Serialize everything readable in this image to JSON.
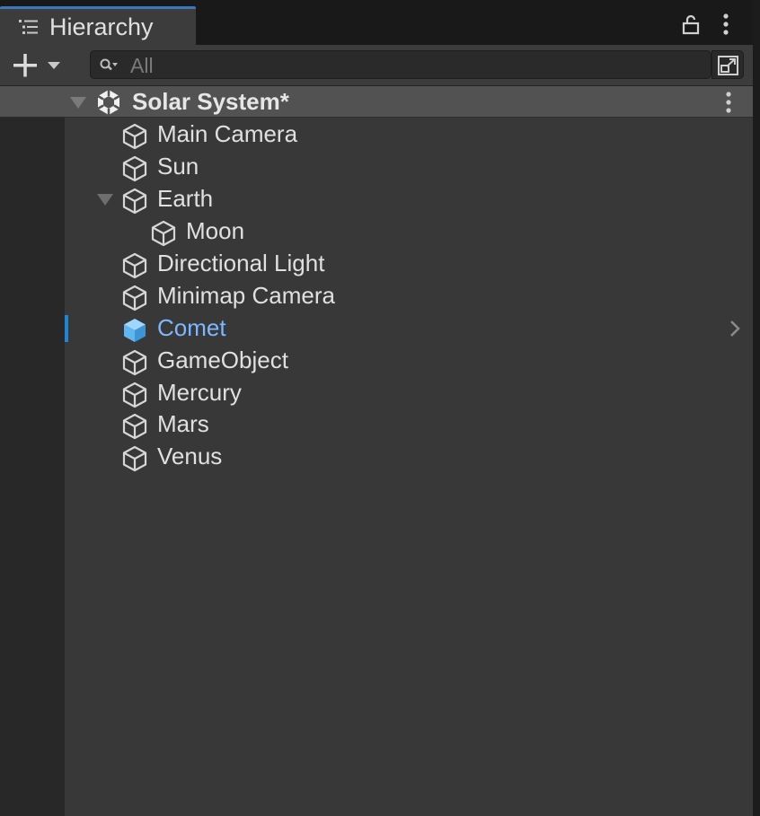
{
  "window": {
    "tab_title": "Hierarchy"
  },
  "toolbar": {
    "search_placeholder": "All"
  },
  "scene": {
    "name": "Solar System*"
  },
  "tree": [
    {
      "label": "Main Camera",
      "depth": 1,
      "expanded": null,
      "selected": false
    },
    {
      "label": "Sun",
      "depth": 1,
      "expanded": null,
      "selected": false
    },
    {
      "label": "Earth",
      "depth": 1,
      "expanded": true,
      "selected": false
    },
    {
      "label": "Moon",
      "depth": 2,
      "expanded": null,
      "selected": false
    },
    {
      "label": "Directional Light",
      "depth": 1,
      "expanded": null,
      "selected": false
    },
    {
      "label": "Minimap Camera",
      "depth": 1,
      "expanded": null,
      "selected": false
    },
    {
      "label": "Comet",
      "depth": 1,
      "expanded": null,
      "selected": true
    },
    {
      "label": "GameObject",
      "depth": 1,
      "expanded": null,
      "selected": false
    },
    {
      "label": "Mercury",
      "depth": 1,
      "expanded": null,
      "selected": false
    },
    {
      "label": "Mars",
      "depth": 1,
      "expanded": null,
      "selected": false
    },
    {
      "label": "Venus",
      "depth": 1,
      "expanded": null,
      "selected": false
    }
  ],
  "colors": {
    "accent": "#3a79bb",
    "selection_text": "#7db8ff",
    "selection_icon": "#62b6f0"
  },
  "icons": {
    "tab": "list-icon",
    "lock": "lock-icon",
    "more": "vertical-ellipsis-icon",
    "add": "plus-icon",
    "search": "search-icon",
    "popout": "popout-icon",
    "scene": "unity-scene-icon",
    "gameobject": "cube-icon",
    "expand": "fold-arrow-icon",
    "child_nav": "chevron-right-icon"
  }
}
